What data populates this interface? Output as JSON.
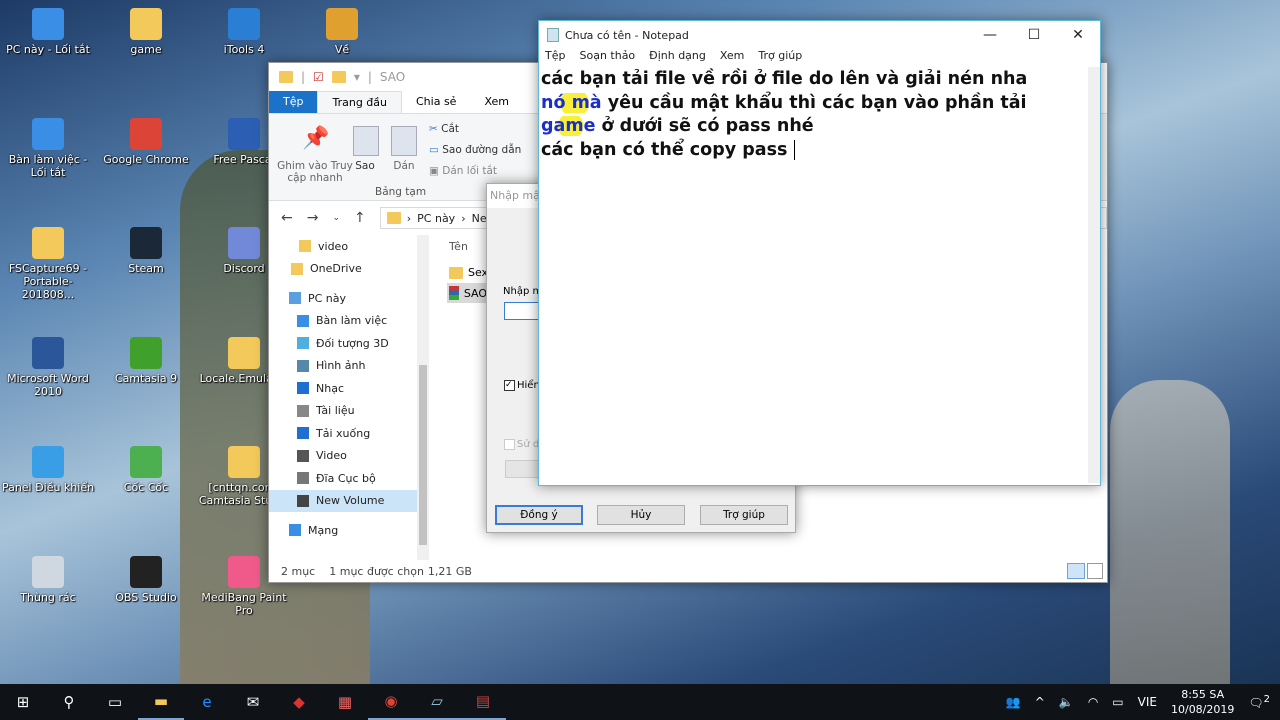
{
  "desktop": {
    "icons": [
      {
        "label": "PC này - Lối tắt",
        "color": "#3a8ee6"
      },
      {
        "label": "game",
        "color": "#f3c95b"
      },
      {
        "label": "iTools 4",
        "color": "#2a7fd4"
      },
      {
        "label": "Về",
        "color": "#e0a030"
      },
      {
        "label": "Bàn làm việc - Lối tắt",
        "color": "#3a8ee6"
      },
      {
        "label": "Google Chrome",
        "color": "#db4437"
      },
      {
        "label": "Free Pascal",
        "color": "#2c5fb3"
      },
      {
        "label": "FSCapture69 - Portable-201808...",
        "color": "#f3c95b"
      },
      {
        "label": "Steam",
        "color": "#1b2838"
      },
      {
        "label": "Discord",
        "color": "#7289da"
      },
      {
        "label": "Microsoft Word 2010",
        "color": "#2b579a"
      },
      {
        "label": "Camtasia 9",
        "color": "#3fa12c"
      },
      {
        "label": "Locale.Emulator",
        "color": "#f3c95b"
      },
      {
        "label": "Panel Điều khiển",
        "color": "#3a9ee6"
      },
      {
        "label": "Cốc Cốc",
        "color": "#4caf50"
      },
      {
        "label": "[cnttqn.com] Camtasia Studio",
        "color": "#f3c95b"
      },
      {
        "label": "Thùng rác",
        "color": "#cfd8e0"
      },
      {
        "label": "OBS Studio",
        "color": "#222222"
      },
      {
        "label": "MediBang Paint Pro",
        "color": "#ef5a8a"
      }
    ]
  },
  "explorer": {
    "title": "SAO",
    "tabs": [
      "Tệp",
      "Trang đầu",
      "Chia sẻ",
      "Xem"
    ],
    "ribbon": {
      "pin": "Ghim vào Truy cập nhanh",
      "copy": "Sao",
      "paste": "Dán",
      "cut": "Cắt",
      "copy_path": "Sao đường dẫn",
      "paste_shortcut": "Dán lối tắt",
      "group": "Bảng tạm"
    },
    "breadcrumb": [
      "PC này",
      "New"
    ],
    "column_name": "Tên",
    "nav": [
      "video",
      "OneDrive",
      "PC này",
      "Bàn làm việc",
      "Đối tượng 3D",
      "Hình ảnh",
      "Nhạc",
      "Tài liệu",
      "Tải xuống",
      "Video",
      "Đĩa Cục bộ",
      "New Volume",
      "Mạng"
    ],
    "files": [
      "Sex",
      "SAO"
    ],
    "status": {
      "count": "2 mục",
      "selected": "1 mục được chọn",
      "size": "1,21 GB"
    }
  },
  "dialog": {
    "title": "Nhập mật",
    "prompt": "Nhập m",
    "show_label": "Hiển",
    "use_label": "Sử d",
    "ok": "Đồng ý",
    "cancel": "Hủy",
    "help": "Trợ giúp"
  },
  "notepad": {
    "title": "Chưa có tên - Notepad",
    "menu": [
      "Tệp",
      "Soạn thảo",
      "Định dạng",
      "Xem",
      "Trợ giúp"
    ],
    "lines": {
      "l1": "các bạn tải file về rồi ở file do lên và giải nén nha",
      "l2a": "nó mà",
      "l2b": " yêu cầu mật khẩu thì các bạn vào phần tải",
      "l3a": "game",
      "l3b": " ở dưới sẽ có pass nhé",
      "l4": "các bạn có thể copy pass "
    }
  },
  "taskbar": {
    "language": "VIE",
    "time": "8:55 SA",
    "date": "10/08/2019",
    "notifications": "2"
  }
}
